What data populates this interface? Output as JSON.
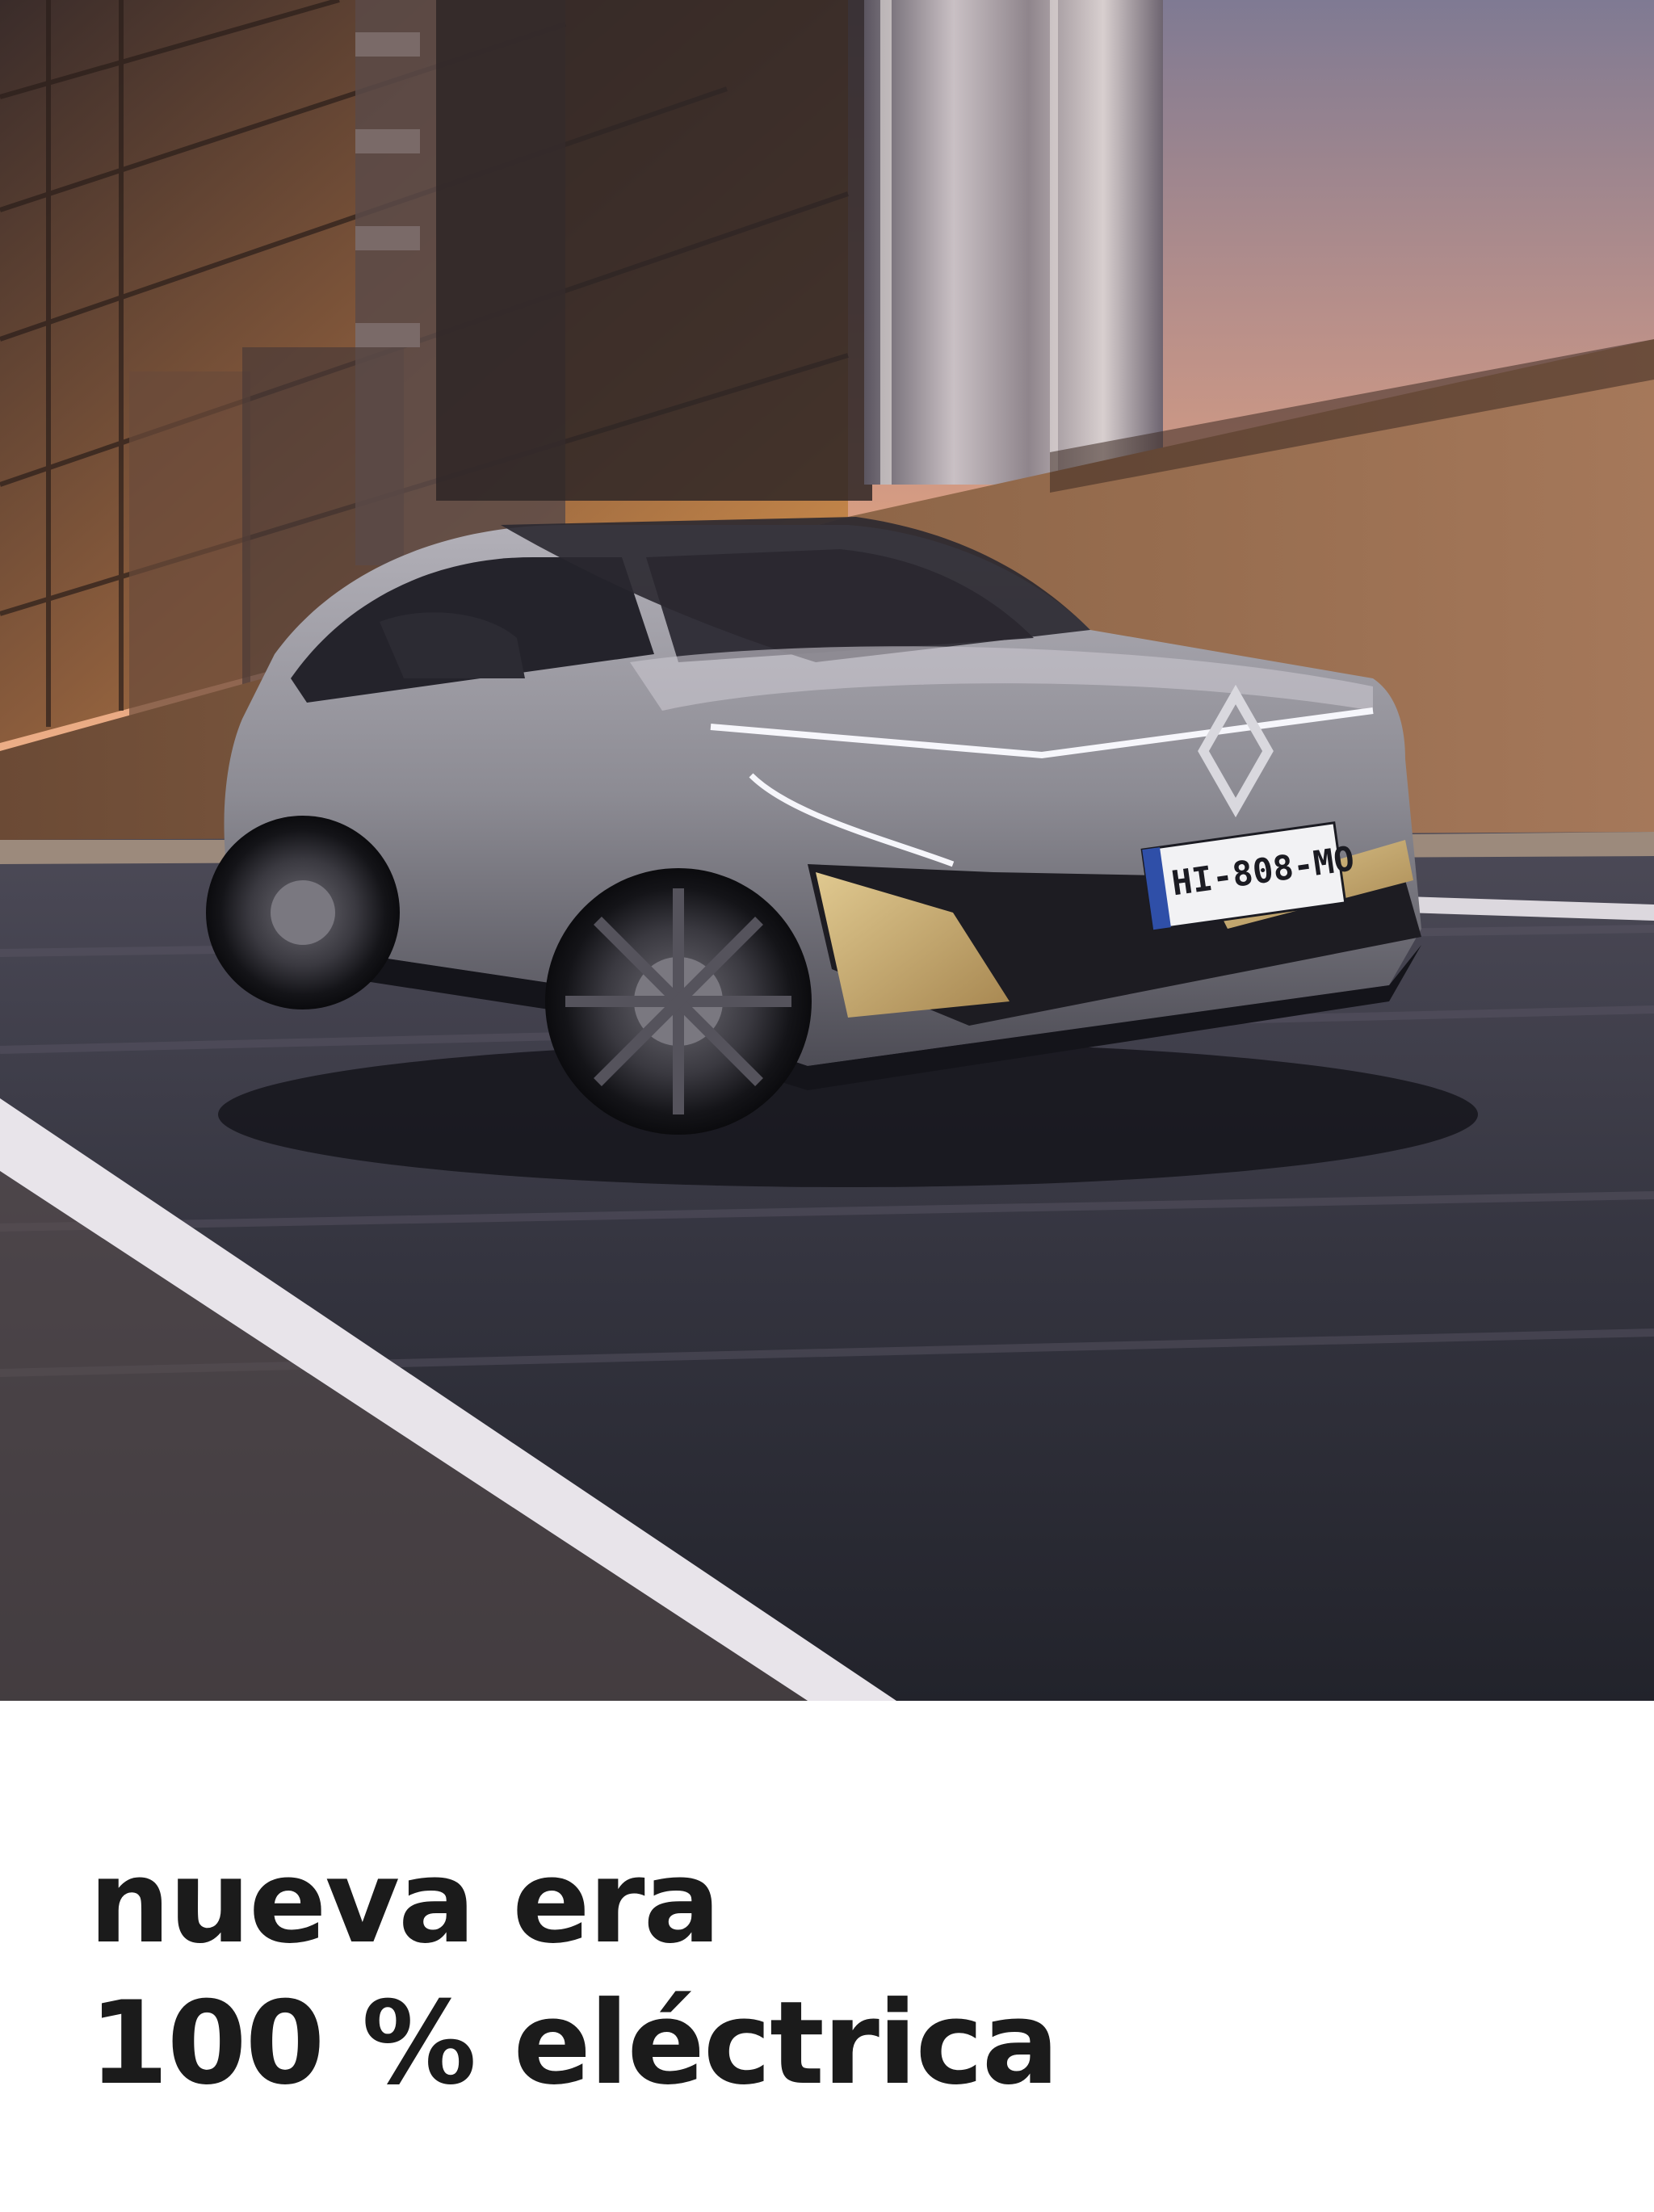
{
  "hero": {
    "license_plate": "HI-808-MO"
  },
  "headline": {
    "line1": "nueva era",
    "line2": "100 % eléctrica"
  },
  "colors": {
    "headline_text": "#1b1b1b",
    "background": "#ffffff",
    "car_body": "#8c8b93",
    "gold_accent": "#c2a464",
    "sky_sunset": "#e9a27a"
  }
}
